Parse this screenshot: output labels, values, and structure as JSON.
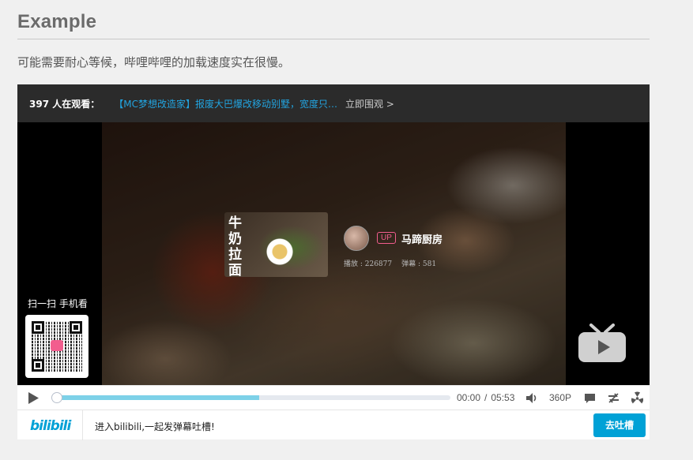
{
  "heading": "Example",
  "note": "可能需要耐心等候，哔哩哔哩的加载速度实在很慢。",
  "player": {
    "topbar": {
      "viewers": "397 人在观看：",
      "video_link": "【MC梦想改造家】报废大巴爆改移动别墅，宽度只…",
      "watch_now": "立即围观 >"
    },
    "card": {
      "thumb_title": "牛奶拉面",
      "up_badge": "UP",
      "up_name": "马蹄厨房",
      "plays": "播放 : 226877",
      "danmaku_count": "弹幕 : 581"
    },
    "qr": {
      "label": "扫一扫 手机看"
    },
    "controls": {
      "current_time": "00:00",
      "separator": "/",
      "duration": "05:53",
      "quality": "360P",
      "buffered_fraction": 0.52
    },
    "danmaku_bar": {
      "logo": "bilibili",
      "prompt": "进入bilibili,一起发弹幕吐槽!",
      "send_label": "去吐槽"
    }
  },
  "colors": {
    "accent": "#00a1d6",
    "link": "#22a4e0",
    "pink": "#f25d8e",
    "buffer": "#7dd1e8"
  },
  "icons": [
    "play-icon",
    "volume-icon",
    "danmaku-toggle-icon",
    "loop-icon",
    "radiation-icon",
    "tv-icon"
  ]
}
